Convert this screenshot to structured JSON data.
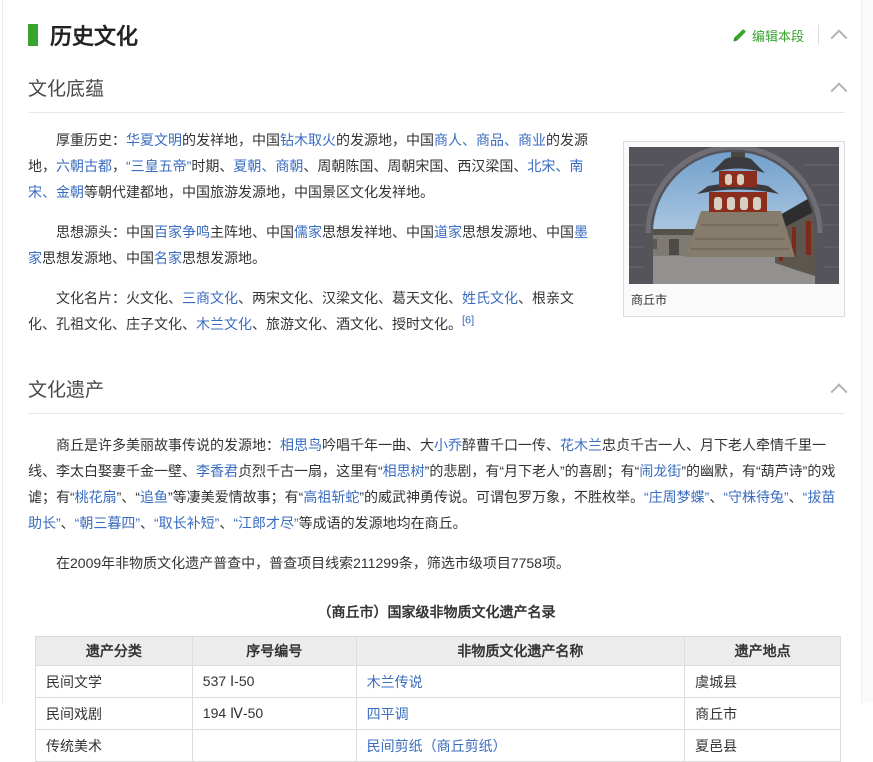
{
  "colors": {
    "accent_green": "#38a42e",
    "link_blue": "#3a6cc0"
  },
  "header": {
    "title": "历史文化",
    "edit_label": "编辑本段"
  },
  "sections": [
    {
      "heading": "文化底蕴"
    },
    {
      "heading": "文化遗产"
    }
  ],
  "image": {
    "caption": "商丘市"
  },
  "paragraphs": {
    "p1": [
      {
        "t": "厚重历史："
      },
      {
        "t": "华夏文明",
        "k": "l"
      },
      {
        "t": "的发祥地，中国"
      },
      {
        "t": "钻木取火",
        "k": "l"
      },
      {
        "t": "的发源地，中国"
      },
      {
        "t": "商人",
        "k": "l"
      },
      {
        "t": "、",
        "k": "l"
      },
      {
        "t": "商品",
        "k": "l"
      },
      {
        "t": "、",
        "k": "l"
      },
      {
        "t": "商业",
        "k": "l"
      },
      {
        "t": "的发源地，"
      },
      {
        "t": "六朝古都",
        "k": "l"
      },
      {
        "t": "，"
      },
      {
        "t": "“三皇五帝”",
        "k": "l"
      },
      {
        "t": "时期、"
      },
      {
        "t": "夏朝",
        "k": "l"
      },
      {
        "t": "、",
        "k": "l"
      },
      {
        "t": "商朝",
        "k": "l"
      },
      {
        "t": "、周朝陈国、周朝宋国、西汉梁国、"
      },
      {
        "t": "北宋",
        "k": "l"
      },
      {
        "t": "、",
        "k": "l"
      },
      {
        "t": "南宋",
        "k": "l"
      },
      {
        "t": "、",
        "k": "l"
      },
      {
        "t": "金朝",
        "k": "l"
      },
      {
        "t": "等朝代建都地，中国旅游发源地，中国景区文化发祥地。"
      }
    ],
    "p2": [
      {
        "t": "思想源头：中国"
      },
      {
        "t": "百家争鸣",
        "k": "l"
      },
      {
        "t": "主阵地、中国"
      },
      {
        "t": "儒家",
        "k": "l"
      },
      {
        "t": "思想发祥地、中国"
      },
      {
        "t": "道家",
        "k": "l"
      },
      {
        "t": "思想发源地、中国"
      },
      {
        "t": "墨家",
        "k": "l"
      },
      {
        "t": "思想发源地、中国"
      },
      {
        "t": "名家",
        "k": "l"
      },
      {
        "t": "思想发源地。"
      }
    ],
    "p3": [
      {
        "t": "文化名片：火文化、"
      },
      {
        "t": "三商文化",
        "k": "l"
      },
      {
        "t": "、两宋文化、汉梁文化、葛天文化、"
      },
      {
        "t": "姓氏文化",
        "k": "l"
      },
      {
        "t": "、根亲文化、孔祖文化、庄子文化、"
      },
      {
        "t": "木兰文化",
        "k": "l"
      },
      {
        "t": "、旅游文化、酒文化、授时文化。"
      },
      {
        "t": "[6]",
        "k": "s"
      }
    ],
    "p4": [
      {
        "t": "商丘是许多美丽故事传说的发源地："
      },
      {
        "t": "相思鸟",
        "k": "l"
      },
      {
        "t": "吟唱千年一曲、大"
      },
      {
        "t": "小乔",
        "k": "l"
      },
      {
        "t": "醉曹千口一传、"
      },
      {
        "t": "花木兰",
        "k": "l"
      },
      {
        "t": "忠贞千古一人、月下老人牵情千里一线、李太白娶妻千金一壁、"
      },
      {
        "t": "李香君",
        "k": "l"
      },
      {
        "t": "贞烈千古一扇，这里有“"
      },
      {
        "t": "相思树",
        "k": "l"
      },
      {
        "t": "”的悲剧，有“月下老人”的喜剧；有“"
      },
      {
        "t": "闹龙街",
        "k": "l"
      },
      {
        "t": "”的幽默，有“葫芦诗”的戏谑；有“"
      },
      {
        "t": "桃花扇",
        "k": "l"
      },
      {
        "t": "”、“"
      },
      {
        "t": "追鱼",
        "k": "l"
      },
      {
        "t": "”等凄美爱情故事；有“"
      },
      {
        "t": "高祖斩蛇",
        "k": "l"
      },
      {
        "t": "”的威武神勇传说。可谓包罗万象，不胜枚举。"
      },
      {
        "t": "“庄周梦蝶”",
        "k": "l"
      },
      {
        "t": "、"
      },
      {
        "t": "“守株待兔”",
        "k": "l"
      },
      {
        "t": "、"
      },
      {
        "t": "“拔苗助长”",
        "k": "l"
      },
      {
        "t": "、"
      },
      {
        "t": "“朝三暮四”",
        "k": "l"
      },
      {
        "t": "、"
      },
      {
        "t": "“取长补短”",
        "k": "l"
      },
      {
        "t": "、"
      },
      {
        "t": "“江郎才尽”",
        "k": "l"
      },
      {
        "t": "等成语的发源地均在商丘。"
      }
    ],
    "p5": [
      {
        "t": "在2009年非物质文化遗产普查中，普查项目线索211299条，筛选市级项目7758项。"
      }
    ]
  },
  "table": {
    "title": "（商丘市）国家级非物质文化遗产名录",
    "headers": [
      "遗产分类",
      "序号编号",
      "非物质文化遗产名称",
      "遗产地点"
    ],
    "rows": [
      [
        {
          "t": "民间文学"
        },
        {
          "t": "537 Ⅰ-50"
        },
        {
          "t": "木兰传说",
          "k": "l"
        },
        {
          "t": "虞城县"
        }
      ],
      [
        {
          "t": "民间戏剧"
        },
        {
          "t": "194 Ⅳ-50"
        },
        {
          "t": "四平调",
          "k": "l"
        },
        {
          "t": "商丘市"
        }
      ],
      [
        {
          "t": "传统美术"
        },
        {
          "t": ""
        },
        {
          "t": "民间剪纸（商丘剪纸）",
          "k": "l"
        },
        {
          "t": "夏邑县"
        }
      ]
    ]
  }
}
